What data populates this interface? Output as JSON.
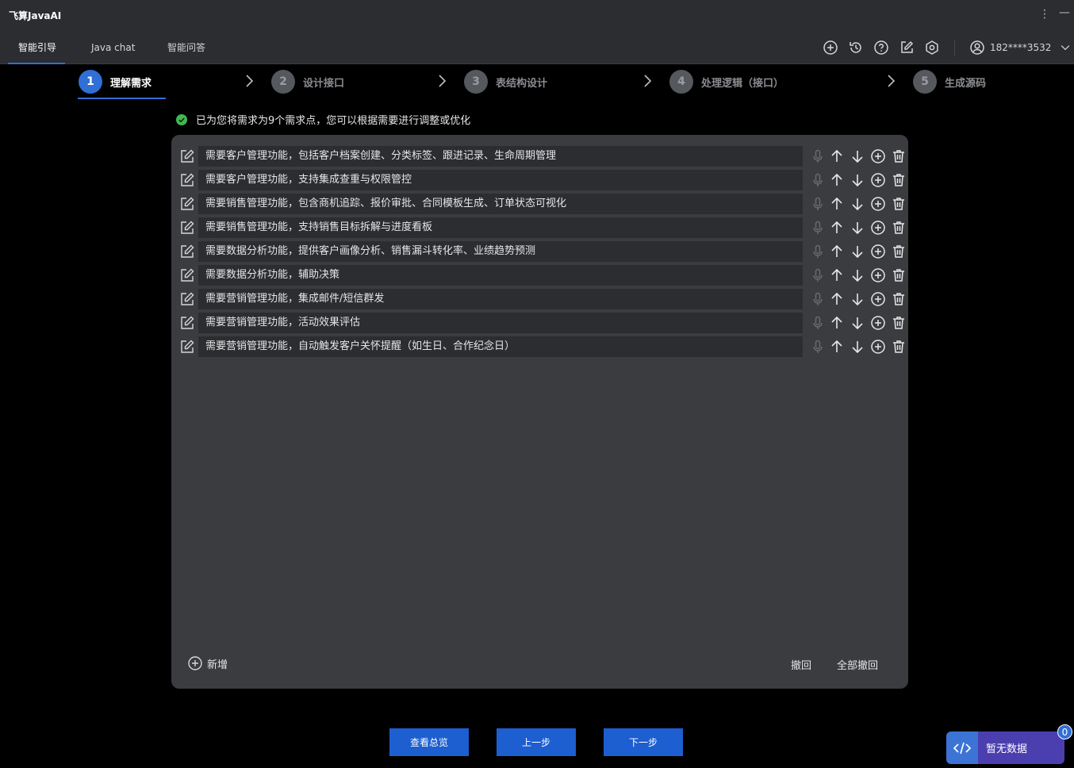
{
  "app": {
    "title": "飞算JavaAI"
  },
  "tabs": [
    {
      "label": "智能引导",
      "active": true
    },
    {
      "label": "Java chat",
      "active": false
    },
    {
      "label": "智能问答",
      "active": false
    }
  ],
  "toolbar": {
    "icons": [
      "add-circle-icon",
      "history-icon",
      "help-icon",
      "edit-icon",
      "settings-icon"
    ],
    "user": "182****3532"
  },
  "steps": [
    {
      "num": "1",
      "label": "理解需求",
      "active": true
    },
    {
      "num": "2",
      "label": "设计接口",
      "active": false
    },
    {
      "num": "3",
      "label": "表结构设计",
      "active": false
    },
    {
      "num": "4",
      "label": "处理逻辑（接口）",
      "active": false
    },
    {
      "num": "5",
      "label": "生成源码",
      "active": false
    }
  ],
  "notice": "已为您将需求为9个需求点，您可以根据需要进行调整或优化",
  "requirements": [
    "需要客户管理功能，包括客户档案创建、分类标签、跟进记录、生命周期管理",
    "需要客户管理功能，支持集成查重与权限管控",
    "需要销售管理功能，包含商机追踪、报价审批、合同模板生成、订单状态可视化",
    "需要销售管理功能，支持销售目标拆解与进度看板",
    "需要数据分析功能，提供客户画像分析、销售漏斗转化率、业绩趋势预测",
    "需要数据分析功能，辅助决策",
    "需要营销管理功能，集成邮件/短信群发",
    "需要营销管理功能，活动效果评估",
    "需要营销管理功能，自动触发客户关怀提醒（如生日、合作纪念日）"
  ],
  "panel_footer": {
    "add": "新增",
    "undo": "撤回",
    "undo_all": "全部撤回"
  },
  "bottom_buttons": {
    "overview": "查看总览",
    "prev": "上一步",
    "next": "下一步"
  },
  "code_widget": {
    "label": "暂无数据",
    "badge": "0"
  },
  "colors": {
    "accent": "#2f6fd6",
    "success": "#3fb950",
    "panel": "#3a3c40",
    "background": "#000000"
  }
}
